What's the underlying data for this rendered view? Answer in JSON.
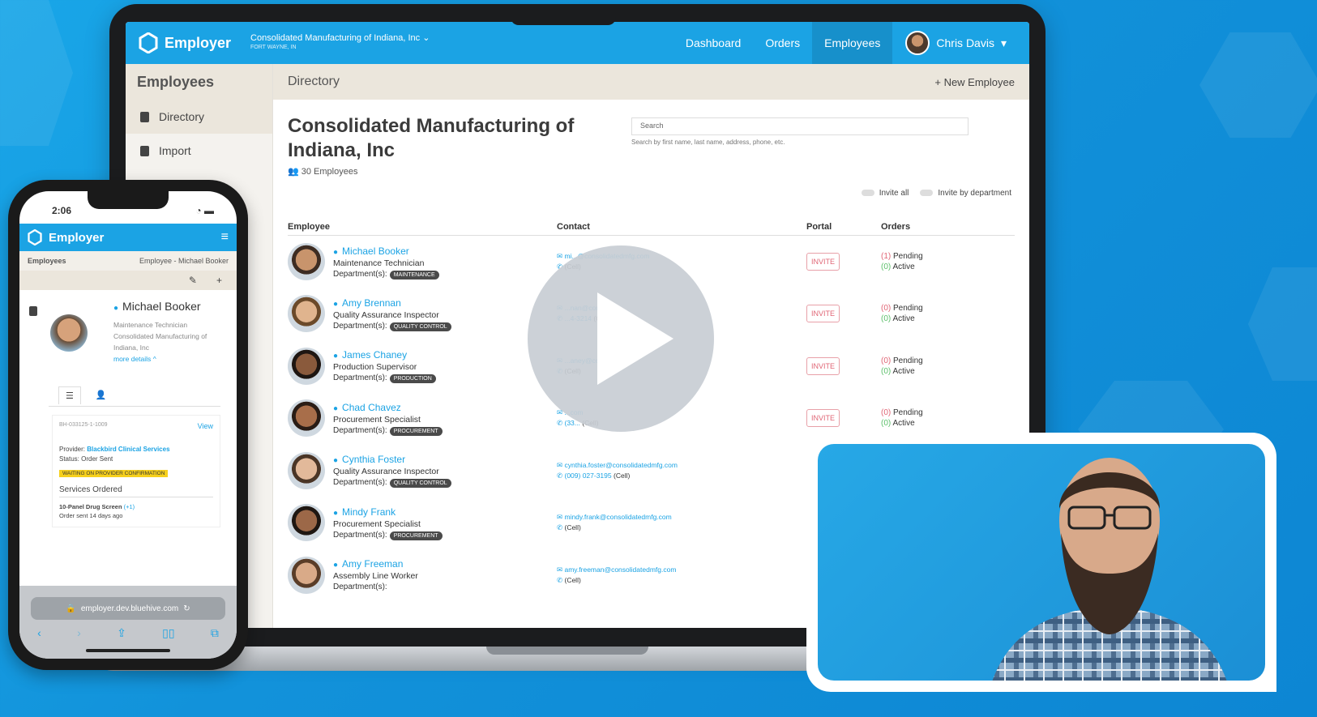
{
  "app": {
    "name": "Employer",
    "company": "Consolidated Manufacturing of Indiana, Inc",
    "location": "FORT WAYNE, IN"
  },
  "nav": {
    "items": [
      "Dashboard",
      "Orders",
      "Employees"
    ],
    "active": "Employees",
    "user": "Chris Davis"
  },
  "sidebar": {
    "title": "Employees",
    "items": [
      "Directory",
      "Import"
    ]
  },
  "main": {
    "section": "Directory",
    "new_button": "+ New Employee",
    "company_title": "Consolidated Manufacturing of Indiana, Inc",
    "employee_count": "30 Employees",
    "search_placeholder": "Search",
    "search_hint": "Search by first name, last name, address, phone, etc.",
    "invite_all": "Invite all",
    "invite_by_department": "Invite by department"
  },
  "table": {
    "headers": [
      "Employee",
      "Contact",
      "Portal",
      "Orders"
    ],
    "dept_label": "Department(s):",
    "invite_label": "INVITE",
    "pending_label": "Pending",
    "active_label": "Active",
    "rows": [
      {
        "name": "Michael Booker",
        "role": "Maintenance Technician",
        "dept": "MAINTENANCE",
        "email": "mi...@consolidatedmfg.com",
        "phone": "",
        "pending": "(1)",
        "active": "(0)"
      },
      {
        "name": "Amy Brennan",
        "role": "Quality Assurance Inspector",
        "dept": "QUALITY CONTROL",
        "email": "...nan@con...",
        "phone": "...4-3214",
        "pending": "(0)",
        "active": "(0)"
      },
      {
        "name": "James Chaney",
        "role": "Production Supervisor",
        "dept": "PRODUCTION",
        "email": "...aney@consoli...",
        "phone": "",
        "pending": "(0)",
        "active": "(0)"
      },
      {
        "name": "Chad Chavez",
        "role": "Procurement Specialist",
        "dept": "PROCUREMENT",
        "email": "...com",
        "phone": "(33...",
        "pending": "(0)",
        "active": "(0)"
      },
      {
        "name": "Cynthia Foster",
        "role": "Quality Assurance Inspector",
        "dept": "QUALITY CONTROL",
        "email": "cynthia.foster@consolidatedmfg.com",
        "phone": "(009) 027-3195",
        "pending": "",
        "active": ""
      },
      {
        "name": "Mindy Frank",
        "role": "Procurement Specialist",
        "dept": "PROCUREMENT",
        "email": "mindy.frank@consolidatedmfg.com",
        "phone": "",
        "pending": "",
        "active": ""
      },
      {
        "name": "Amy Freeman",
        "role": "Assembly Line Worker",
        "dept": "",
        "email": "amy.freeman@consolidatedmfg.com",
        "phone": "",
        "pending": "",
        "active": ""
      }
    ],
    "cell_label": "(Cell)"
  },
  "phone": {
    "time": "2:06",
    "app_name": "Employer",
    "crumb_left": "Employees",
    "crumb_right": "Employee - Michael Booker",
    "profile_name": "Michael Booker",
    "profile_role": "Maintenance Technician",
    "profile_company": "Consolidated Manufacturing of Indiana, Inc",
    "more_details": "more details",
    "order_id": "BH-033125-1-1009",
    "view": "View",
    "provider_label": "Provider:",
    "provider": "Blackbird Clinical Services",
    "status": "Status: Order Sent",
    "warning": "WAITING ON PROVIDER CONFIRMATION",
    "services_title": "Services Ordered",
    "service": "10-Panel Drug Screen",
    "service_extra": "(+1)",
    "order_sent": "Order sent 14 days ago",
    "url": "employer.dev.bluehive.com"
  },
  "colors": {
    "brand": "#1ba3e4",
    "background": "#1292da",
    "invite": "#e06575",
    "active": "#5bbf6a",
    "warning": "#f6d01c"
  }
}
